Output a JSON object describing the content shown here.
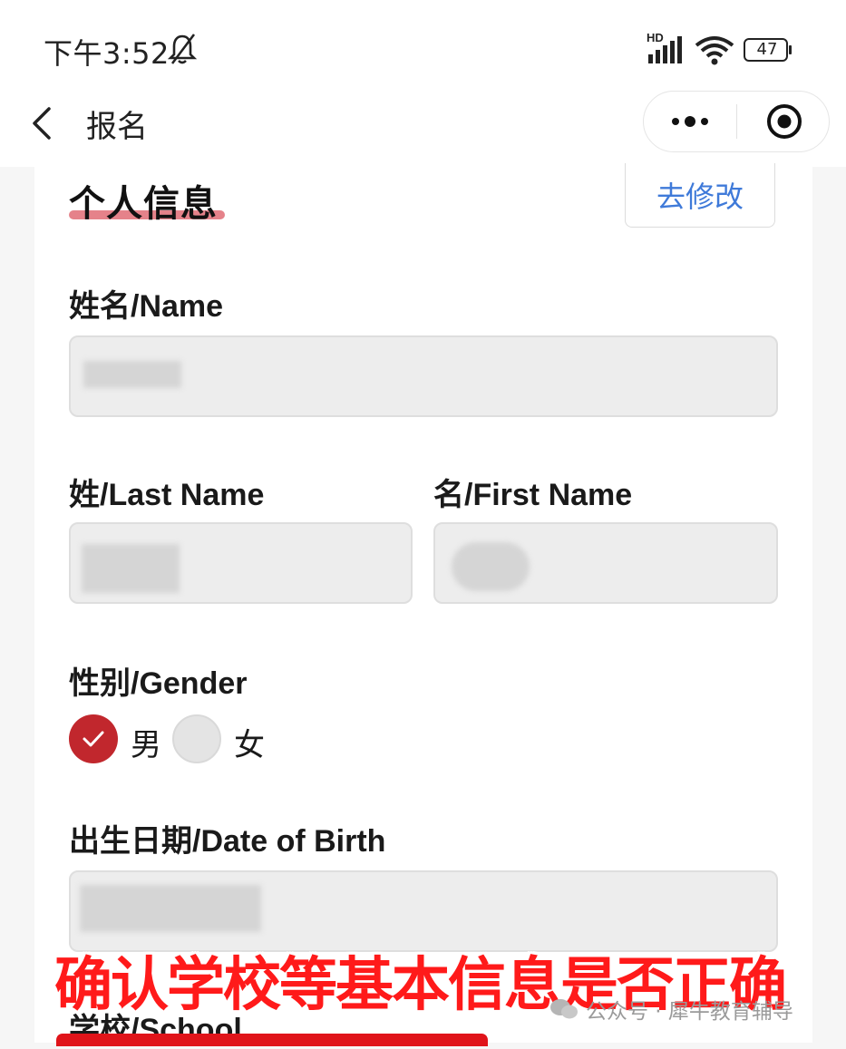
{
  "status_bar": {
    "time": "下午3:52",
    "network_badge": "HD",
    "battery": "47",
    "icons": [
      "bell-muted-icon",
      "signal-icon",
      "wifi-icon",
      "battery-icon"
    ]
  },
  "nav": {
    "title": "报名",
    "icons": [
      "back-icon",
      "more-icon",
      "close-target-icon"
    ]
  },
  "section": {
    "title": "个人信息",
    "edit_label": "去修改"
  },
  "form": {
    "name_label": "姓名/Name",
    "last_name_label": "姓/Last Name",
    "first_name_label": "名/First Name",
    "gender_label": "性别/Gender",
    "gender_options": [
      {
        "label": "男",
        "checked": true
      },
      {
        "label": "女",
        "checked": false
      }
    ],
    "dob_label": "出生日期/Date of Birth",
    "school_label": "学校/School"
  },
  "overlay": {
    "caption": "确认学校等基本信息是否正确",
    "watermark": "公众号 · 犀牛教育辅导"
  },
  "colors": {
    "accent": "#c1272d",
    "link": "#3f7ad9",
    "caption": "#ff1a1a"
  }
}
